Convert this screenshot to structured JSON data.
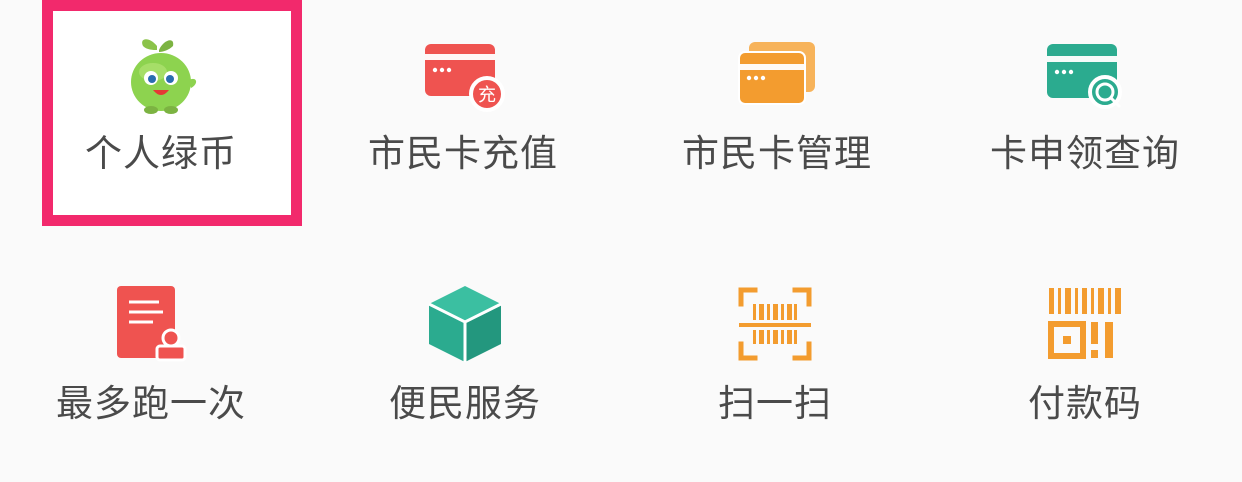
{
  "colors": {
    "highlight_border": "#f2296c",
    "red": "#ef5350",
    "orange": "#f39c2f",
    "teal": "#2bab8f",
    "label_text": "#4a4a4a"
  },
  "services": [
    {
      "label": "个人绿币",
      "icon": "green-mascot-icon",
      "highlighted": true
    },
    {
      "label": "市民卡充值",
      "icon": "card-recharge-icon",
      "badge": "充"
    },
    {
      "label": "市民卡管理",
      "icon": "card-management-icon"
    },
    {
      "label": "卡申领查询",
      "icon": "card-search-icon"
    },
    {
      "label": "最多跑一次",
      "icon": "document-stamp-icon"
    },
    {
      "label": "便民服务",
      "icon": "cube-icon"
    },
    {
      "label": "扫一扫",
      "icon": "scan-icon"
    },
    {
      "label": "付款码",
      "icon": "payment-code-icon"
    }
  ]
}
